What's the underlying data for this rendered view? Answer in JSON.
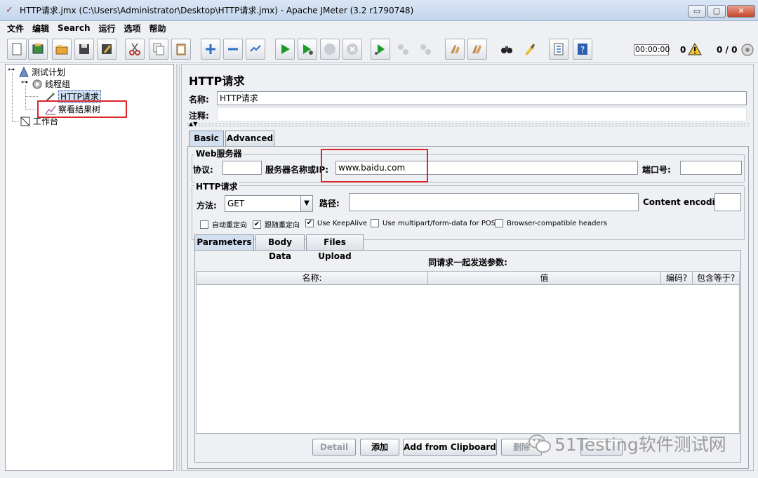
{
  "window": {
    "title": "HTTP请求.jmx (C:\\Users\\Administrator\\Desktop\\HTTP请求.jmx) - Apache JMeter (3.2 r1790748)",
    "minimize": "▭",
    "maximize": "▢",
    "close": "✕"
  },
  "menu": [
    "文件",
    "编辑",
    "Search",
    "运行",
    "选项",
    "帮助"
  ],
  "toolbar": {
    "timer": "00:00:00",
    "warning_count": "0",
    "thread_count": "0 / 0",
    "icons": [
      "new-icon",
      "templates-icon",
      "open-icon",
      "save-icon",
      "save-as-icon",
      "cut-icon",
      "copy-icon",
      "paste-icon",
      "expand-icon",
      "collapse-icon",
      "toggle-icon",
      "start-icon",
      "start-no-pause-icon",
      "stop-icon",
      "shutdown-icon",
      "remote-start-icon",
      "remote-stop-icon",
      "remote-shutdown-icon",
      "clear-icon",
      "clear-all-icon",
      "search-icon",
      "reset-search-icon",
      "function-helper-icon",
      "help-icon"
    ]
  },
  "tree": {
    "items": [
      {
        "label": "测试计划",
        "icon": "test-plan-icon"
      },
      {
        "label": "线程组",
        "icon": "thread-group-icon"
      },
      {
        "label": "HTTP请求",
        "icon": "http-sampler-icon"
      },
      {
        "label": "察看结果树",
        "icon": "listener-icon"
      },
      {
        "label": "工作台",
        "icon": "workbench-icon"
      }
    ]
  },
  "form": {
    "title": "HTTP请求",
    "name_label": "名称:",
    "name_value": "HTTP请求",
    "comment_label": "注释:",
    "tabs": [
      "Basic",
      "Advanced"
    ],
    "web_server": {
      "group_title": "Web服务器",
      "protocol_label": "协议:",
      "protocol_value": "",
      "server_label": "服务器名称或IP:",
      "server_value": "www.baidu.com",
      "port_label": "端口号:",
      "port_value": ""
    },
    "http_request": {
      "group_title": "HTTP请求",
      "method_label": "方法:",
      "method_value": "GET",
      "path_label": "路径:",
      "path_value": "",
      "encoding_label": "Content encoding:",
      "encoding_value": ""
    },
    "checkboxes": [
      {
        "label": "自动重定向",
        "checked": false
      },
      {
        "label": "跟随重定向",
        "checked": true
      },
      {
        "label": "Use KeepAlive",
        "checked": true
      },
      {
        "label": "Use multipart/form-data for POST",
        "checked": false
      },
      {
        "label": "Browser-compatible headers",
        "checked": false
      }
    ],
    "sub_tabs": [
      "Parameters",
      "Body Data",
      "Files Upload"
    ],
    "params_caption": "同请求一起发送参数:",
    "columns": [
      "名称:",
      "值",
      "编码?",
      "包含等于?"
    ],
    "buttons": [
      "Detail",
      "添加",
      "Add from Clipboard",
      "删除"
    ]
  },
  "watermark": "51Testing软件测试网"
}
